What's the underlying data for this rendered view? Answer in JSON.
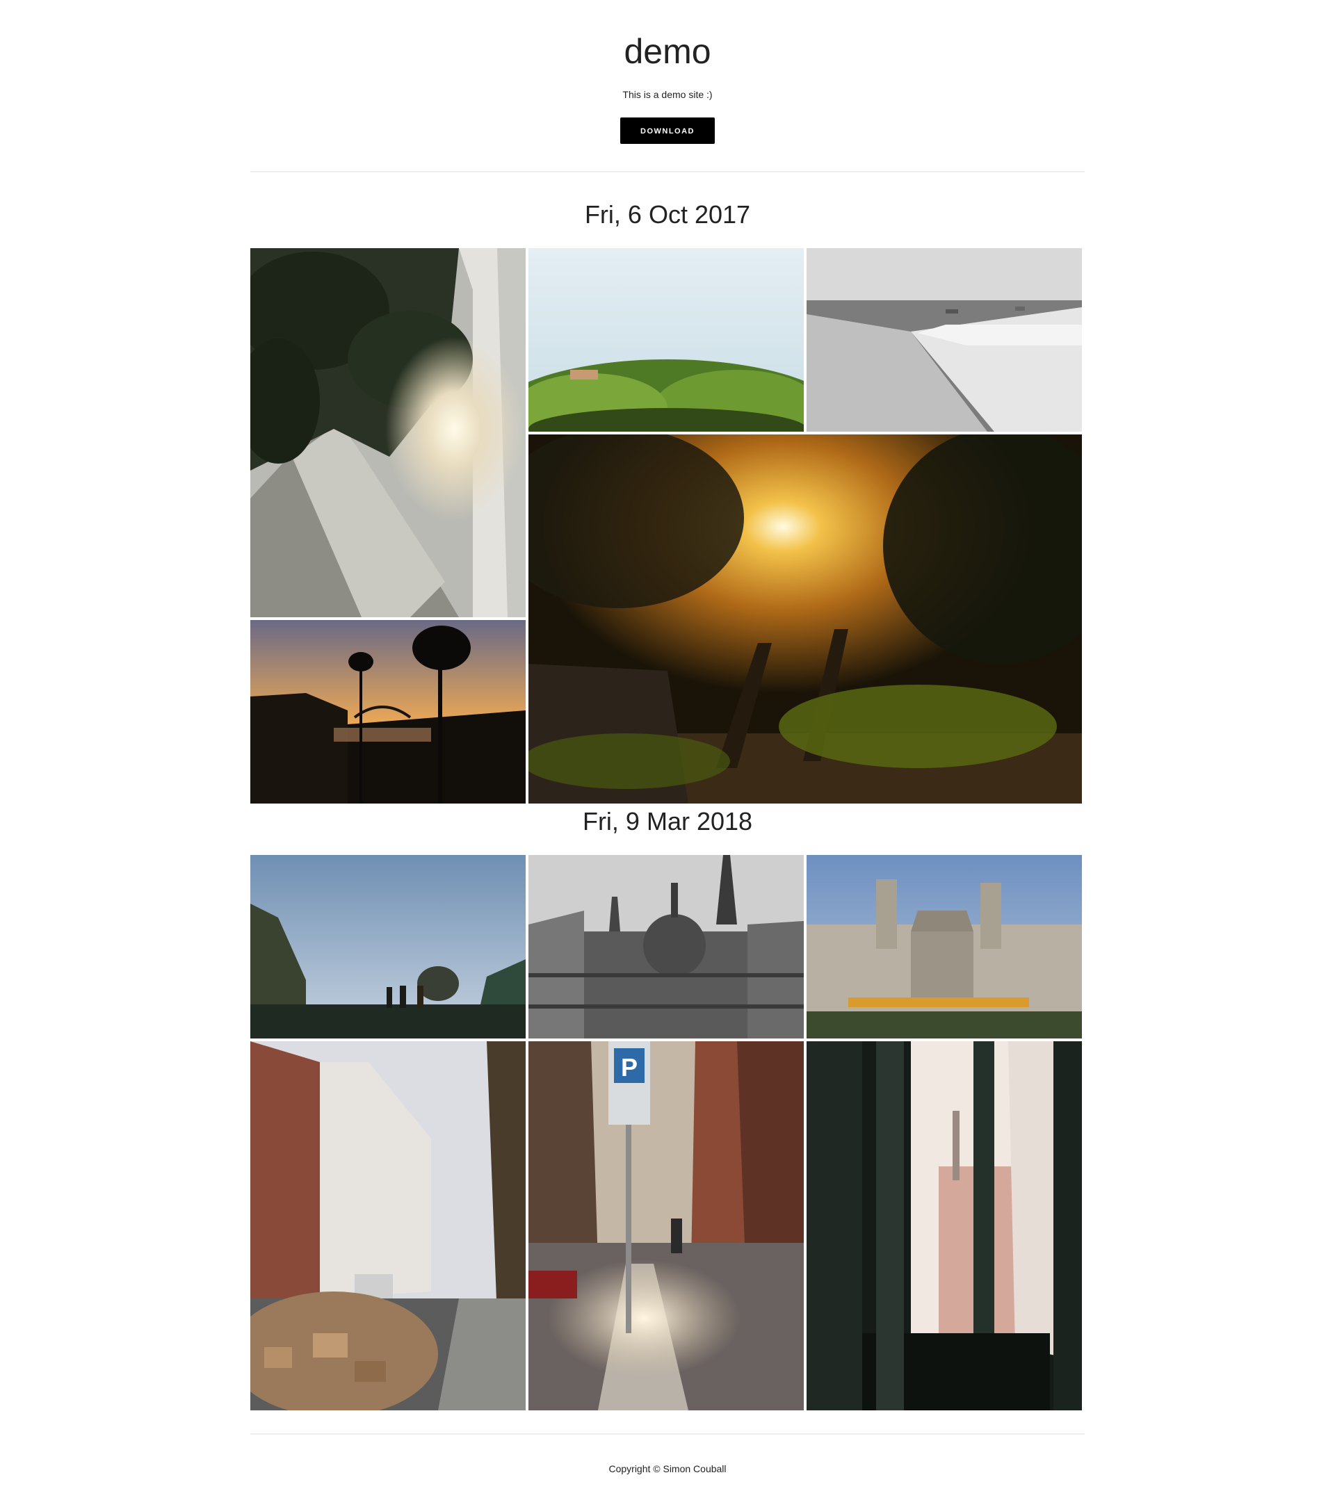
{
  "site": {
    "title": "demo",
    "description": "This is a demo site :)",
    "download_label": "DOWNLOAD"
  },
  "galleries": [
    {
      "date": "Fri, 6 Oct 2017",
      "photos": [
        {
          "subject": "trees and concrete staircase with sunbeams"
        },
        {
          "subject": "green succulent plants against pale sky"
        },
        {
          "subject": "black and white beach with waves"
        },
        {
          "subject": "sun shining through trees in park"
        },
        {
          "subject": "palm tree silhouettes at sunset over river and bridge"
        }
      ]
    },
    {
      "date": "Fri, 9 Mar 2018",
      "photos": [
        {
          "subject": "people silhouetted on stairs under blue sky"
        },
        {
          "subject": "black and white gothic parliament building"
        },
        {
          "subject": "neoclassical building with columns and tram"
        },
        {
          "subject": "city street with piled cardboard boxes"
        },
        {
          "subject": "parking sign on sunny sidewalk"
        },
        {
          "subject": "open window frame looking at building and chimney"
        }
      ]
    }
  ],
  "footer": {
    "copyright": "Copyright © Simon Couball"
  }
}
